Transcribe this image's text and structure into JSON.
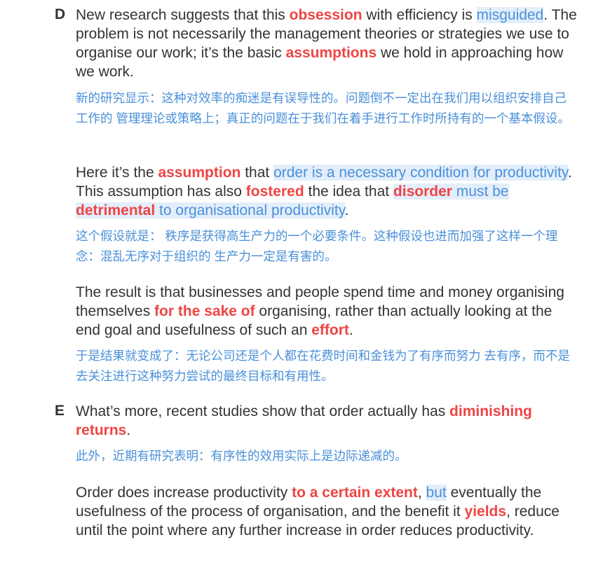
{
  "sections": {
    "d": {
      "letter": "D",
      "p1": {
        "s1": "New research suggests that this ",
        "kw1": "obsession",
        "s2": " with efficiency is ",
        "hl1": "misguided",
        "s3": ". The problem is not necessarily the management theories or strategies we use to organise our work; it’s the basic ",
        "kw2": "assumptions",
        "s4": " we hold in approaching how we work."
      },
      "t1": "新的研究显示：这种对效率的痴迷是有误导性的。问题倒不一定出在我们用以组织安排自己工作的 管理理论或策略上；真正的问题在于我们在着手进行工作时所持有的一个基本假设。",
      "p2": {
        "s1": "Here it’s the ",
        "kw1": "assumption",
        "s2": " that ",
        "hl1": "order is a necessary condition for productivity",
        "s3": ". This assumption has also ",
        "kw2": "fostered",
        "s4": " the idea that ",
        "kw3": "disorder",
        "hl2": " must be ",
        "kw4": "detrimental",
        "hl3": " to organisational productivity",
        "s5": "."
      },
      "t2": "这个假设就是： 秩序是获得高生产力的一个必要条件。这种假设也进而加强了这样一个理念：混乱无序对于组织的 生产力一定是有害的。",
      "p3": {
        "s1": "The result is that businesses and people spend time and money organising themselves ",
        "kw1": "for the sake of",
        "s2": " organising, rather than actually looking at the end goal and usefulness of such an ",
        "kw2": "effort",
        "s3": "."
      },
      "t3": "于是结果就变成了：无论公司还是个人都在花费时间和金钱为了有序而努力 去有序，而不是去关注进行这种努力尝试的最终目标和有用性。"
    },
    "e": {
      "letter": "E",
      "p1": {
        "s1": "What’s more, recent studies show that order actually has ",
        "kw1": "diminishing returns",
        "s2": "."
      },
      "t1": "此外，近期有研究表明：有序性的效用实际上是边际递减的。",
      "p2": {
        "s1": "Order does increase productivity ",
        "kw1": "to a certain extent",
        "s2": ", ",
        "hl1": "but",
        "s3": " eventually the usefulness of the process of organisation, and the benefit it ",
        "kw2": "yields",
        "s4": ", reduce until the point where any further increase in order reduces productivity."
      }
    }
  },
  "colors": {
    "text": "#333333",
    "keyword": "#ef4444",
    "translation": "#4a90d9",
    "highlight_bg": "#e3eefb"
  }
}
